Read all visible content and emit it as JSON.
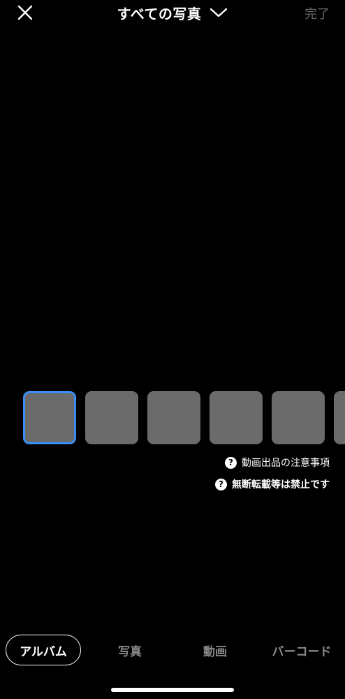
{
  "header": {
    "title": "すべての写真",
    "done_label": "完了"
  },
  "thumbnails": {
    "count": 6,
    "selected_index": 0
  },
  "notes": [
    {
      "label": "動画出品の注意事項",
      "bold": false
    },
    {
      "label": "無断転載等は禁止です",
      "bold": true
    }
  ],
  "tabs": [
    {
      "label": "アルバム",
      "active": true
    },
    {
      "label": "写真",
      "active": false
    },
    {
      "label": "動画",
      "active": false
    },
    {
      "label": "バーコード",
      "active": false
    }
  ],
  "colors": {
    "background": "#000000",
    "thumbnail": "#6b6b6b",
    "selected_border": "#3a8ef6",
    "inactive_text": "#8a8a8a",
    "done_disabled": "#666666"
  },
  "icons": {
    "close": "close-icon",
    "dropdown": "chevron-down-icon",
    "help": "help-circle-icon"
  }
}
